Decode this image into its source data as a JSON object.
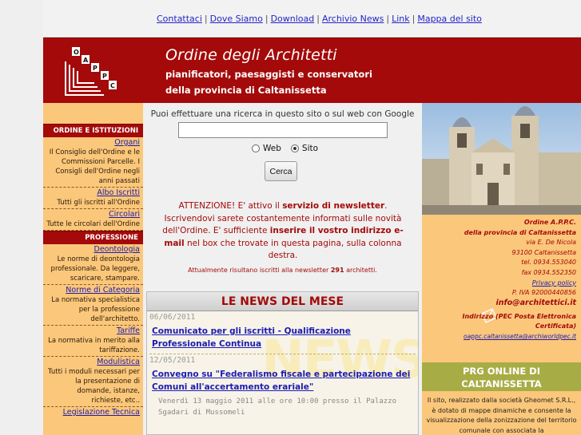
{
  "topnav": {
    "links": [
      "Contattaci",
      "Dove Siamo",
      "Download",
      "Archivio News",
      "Link",
      "Mappa del sito"
    ]
  },
  "header": {
    "logo_letters": [
      "O",
      "A",
      "P",
      "P",
      "C"
    ],
    "title": "Ordine degli Architetti",
    "subtitle_line1": "pianificatori, paesaggisti e conservatori",
    "subtitle_line2": "della provincia di Caltanissetta"
  },
  "sidebar": {
    "sections": [
      {
        "heading": "ORDINE E ISTITUZIONI",
        "items": [
          {
            "label": "Organi",
            "desc": "Il Consiglio dell'Ordine e le Commissioni Parcelle. I Consigli dell'Ordine negli anni passati"
          },
          {
            "label": "Albo Iscritti",
            "desc": "Tutti gli iscritti all'Ordine"
          },
          {
            "label": "Circolari",
            "desc": "Tutte le circolari dell'Ordine"
          }
        ]
      },
      {
        "heading": "PROFESSIONE",
        "items": [
          {
            "label": "Deontologia",
            "desc": "Le norme di deontologia professionale. Da leggere, scaricare, stampare."
          },
          {
            "label": "Norme di Categoria",
            "desc": "La normativa specialistica per la professione dell'architetto."
          },
          {
            "label": "Tariffe",
            "desc": "La normativa in merito alla tariffazione."
          },
          {
            "label": "Modulistica",
            "desc": "Tutti i moduli necessari per la presentazione di domande, istanze, richieste, etc.."
          },
          {
            "label": "Legislazione Tecnica",
            "desc": ""
          }
        ]
      }
    ]
  },
  "search": {
    "prompt": "Puoi effettuare una ricerca in questo sito o sul web con Google",
    "input_value": "",
    "option_web": "Web",
    "option_site": "Sito",
    "selected": "Sito",
    "button": "Cerca"
  },
  "notice": {
    "part1": "ATTENZIONE! E' attivo il ",
    "bold1": "servizio di newsletter",
    "part2": ". Iscrivendovi sarete costantemente informati sulle novità dell'Ordine. E' sufficiente ",
    "bold2": "inserire il vostro indirizzo e-mail",
    "part3": " nel box che trovate in questa pagina, sulla colonna destra.",
    "count_prefix": "Attualmente risultano iscritti alla newsletter ",
    "count": "291",
    "count_suffix": " architetti."
  },
  "news": {
    "heading": "LE NEWS DEL MESE",
    "watermark": "NEWS",
    "items": [
      {
        "date": "06/06/2011",
        "title": "Comunicato per gli iscritti - Qualificazione Professionale Continua",
        "body": ""
      },
      {
        "date": "12/05/2011",
        "title": "Convegno su \"Federalismo fiscale e partecipazione dei Comuni all'accertamento erariale\"",
        "body": "Venerdì 13 maggio 2011 alle ore 10:00 presso il Palazzo Sgadari di Mussomeli"
      }
    ]
  },
  "contact": {
    "org": "Ordine A.P.P.C.",
    "org2": "della provincia di Caltanissetta",
    "street": "via E. De Nicola",
    "city": "93100 Caltanissetta",
    "tel": "tel. 0934.553040",
    "fax": "fax 0934.552350",
    "privacy": "Privacy policy",
    "piva": "P. IVA 92000440856",
    "email": "info@architettici.it",
    "pec_label1": "Indirizzo (PEC Posta Elettronica",
    "pec_label2": "Certificata)",
    "pec_email": "oappc.caltanissetta@archiworldpec.it"
  },
  "prg": {
    "heading1": "PRG ONLINE DI",
    "heading2": "CALTANISSETTA",
    "text": "Il sito, realizzato dalla società Gheomet S.R.L., è dotato di mappe dinamiche e consente la visualizzazione della zonizzazione del territorio comunale con associata la"
  },
  "colors": {
    "brand_red": "#a40a0a",
    "sidebar_orange": "#fbc77a",
    "link_blue": "#1c1cb0",
    "prg_green": "#a7ac45"
  }
}
